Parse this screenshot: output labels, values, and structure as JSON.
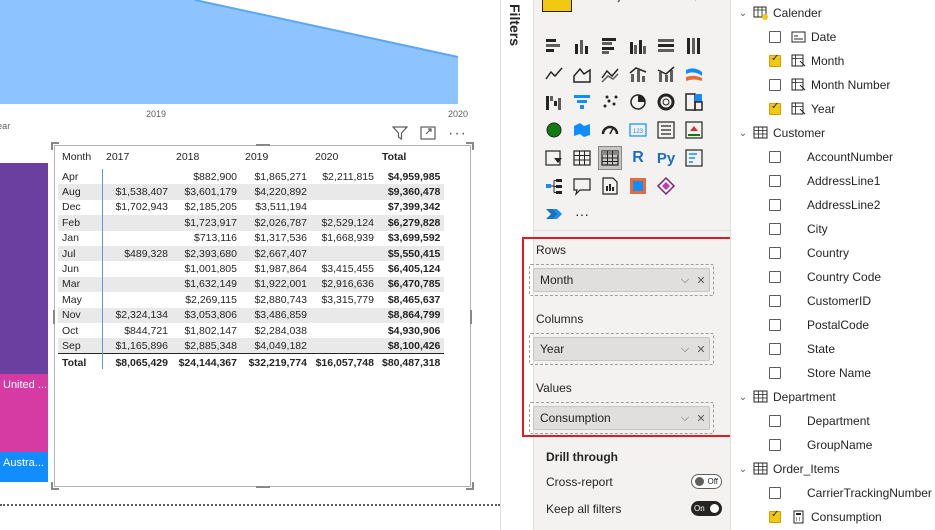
{
  "chart_data": {
    "type": "area",
    "x_tick_labels": [
      "2019",
      "2020"
    ],
    "xlabel": "Year",
    "fill_color": "#8dc3ff",
    "line_color": "#5aa7f5"
  },
  "canvas": {
    "treemap_labels": [
      "United ...",
      "Austra..."
    ],
    "treemap_colors": [
      "#6b3fa0",
      "#d63ba3",
      "#118dff"
    ],
    "matrix": {
      "row_header": "Month",
      "columns": [
        "2017",
        "2018",
        "2019",
        "2020",
        "Total"
      ],
      "rows": [
        {
          "month": "Apr",
          "values": [
            "",
            "$882,900",
            "$1,865,271",
            "$2,211,815",
            "$4,959,985"
          ]
        },
        {
          "month": "Aug",
          "values": [
            "$1,538,407",
            "$3,601,179",
            "$4,220,892",
            "",
            "$9,360,478"
          ]
        },
        {
          "month": "Dec",
          "values": [
            "$1,702,943",
            "$2,185,205",
            "$3,511,194",
            "",
            "$7,399,342"
          ]
        },
        {
          "month": "Feb",
          "values": [
            "",
            "$1,723,917",
            "$2,026,787",
            "$2,529,124",
            "$6,279,828"
          ]
        },
        {
          "month": "Jan",
          "values": [
            "",
            "$713,116",
            "$1,317,536",
            "$1,668,939",
            "$3,699,592"
          ]
        },
        {
          "month": "Jul",
          "values": [
            "$489,328",
            "$2,393,680",
            "$2,667,407",
            "",
            "$5,550,415"
          ]
        },
        {
          "month": "Jun",
          "values": [
            "",
            "$1,001,805",
            "$1,987,864",
            "$3,415,455",
            "$6,405,124"
          ]
        },
        {
          "month": "Mar",
          "values": [
            "",
            "$1,632,149",
            "$1,922,001",
            "$2,916,636",
            "$6,470,785"
          ]
        },
        {
          "month": "May",
          "values": [
            "",
            "$2,269,115",
            "$2,880,743",
            "$3,315,779",
            "$8,465,637"
          ]
        },
        {
          "month": "Nov",
          "values": [
            "$2,324,134",
            "$3,053,806",
            "$3,486,859",
            "",
            "$8,864,799"
          ]
        },
        {
          "month": "Oct",
          "values": [
            "$844,721",
            "$1,802,147",
            "$2,284,038",
            "",
            "$4,930,906"
          ]
        },
        {
          "month": "Sep",
          "values": [
            "$1,165,896",
            "$2,885,348",
            "$4,049,182",
            "",
            "$8,100,426"
          ]
        }
      ],
      "total_row": {
        "month": "Total",
        "values": [
          "$8,065,429",
          "$24,144,367",
          "$32,219,774",
          "$16,057,748",
          "$80,487,318"
        ]
      }
    }
  },
  "filters_pane": {
    "label": "Filters"
  },
  "viz_pane": {
    "wells": {
      "rows_label": "Rows",
      "rows_field": "Month",
      "columns_label": "Columns",
      "columns_field": "Year",
      "values_label": "Values",
      "values_field": "Consumption"
    },
    "drill_through": {
      "title": "Drill through",
      "cross_report_label": "Cross-report",
      "cross_report_state": "Off",
      "keep_filters_label": "Keep all filters",
      "keep_filters_state": "On"
    },
    "more_label": "···",
    "r_label": "R",
    "py_label": "Py",
    "number_label": "123"
  },
  "fields_pane": {
    "items": [
      {
        "type": "table",
        "label": "Calender",
        "icon": "calendar-table-icon",
        "checked": true
      },
      {
        "type": "field",
        "label": "Date",
        "icon": "date-icon",
        "checked": false
      },
      {
        "type": "field",
        "label": "Month",
        "icon": "hierarchy-icon",
        "checked": true
      },
      {
        "type": "field",
        "label": "Month Number",
        "icon": "hierarchy-icon",
        "checked": false
      },
      {
        "type": "field",
        "label": "Year",
        "icon": "hierarchy-icon",
        "checked": true
      },
      {
        "type": "table",
        "label": "Customer",
        "icon": "table-icon",
        "checked": false
      },
      {
        "type": "field",
        "label": "AccountNumber",
        "icon": "",
        "checked": false
      },
      {
        "type": "field",
        "label": "AddressLine1",
        "icon": "",
        "checked": false
      },
      {
        "type": "field",
        "label": "AddressLine2",
        "icon": "",
        "checked": false
      },
      {
        "type": "field",
        "label": "City",
        "icon": "",
        "checked": false
      },
      {
        "type": "field",
        "label": "Country",
        "icon": "",
        "checked": false
      },
      {
        "type": "field",
        "label": "Country Code",
        "icon": "",
        "checked": false
      },
      {
        "type": "field",
        "label": "CustomerID",
        "icon": "",
        "checked": false
      },
      {
        "type": "field",
        "label": "PostalCode",
        "icon": "",
        "checked": false
      },
      {
        "type": "field",
        "label": "State",
        "icon": "",
        "checked": false
      },
      {
        "type": "field",
        "label": "Store Name",
        "icon": "",
        "checked": false
      },
      {
        "type": "table",
        "label": "Department",
        "icon": "table-icon",
        "checked": false
      },
      {
        "type": "field",
        "label": "Department",
        "icon": "",
        "checked": false
      },
      {
        "type": "field",
        "label": "GroupName",
        "icon": "",
        "checked": false
      },
      {
        "type": "table",
        "label": "Order_Items",
        "icon": "table-icon",
        "checked": true
      },
      {
        "type": "field",
        "label": "CarrierTrackingNumber",
        "icon": "",
        "checked": false
      },
      {
        "type": "field",
        "label": "Consumption",
        "icon": "calculator-icon",
        "checked": true
      }
    ]
  }
}
